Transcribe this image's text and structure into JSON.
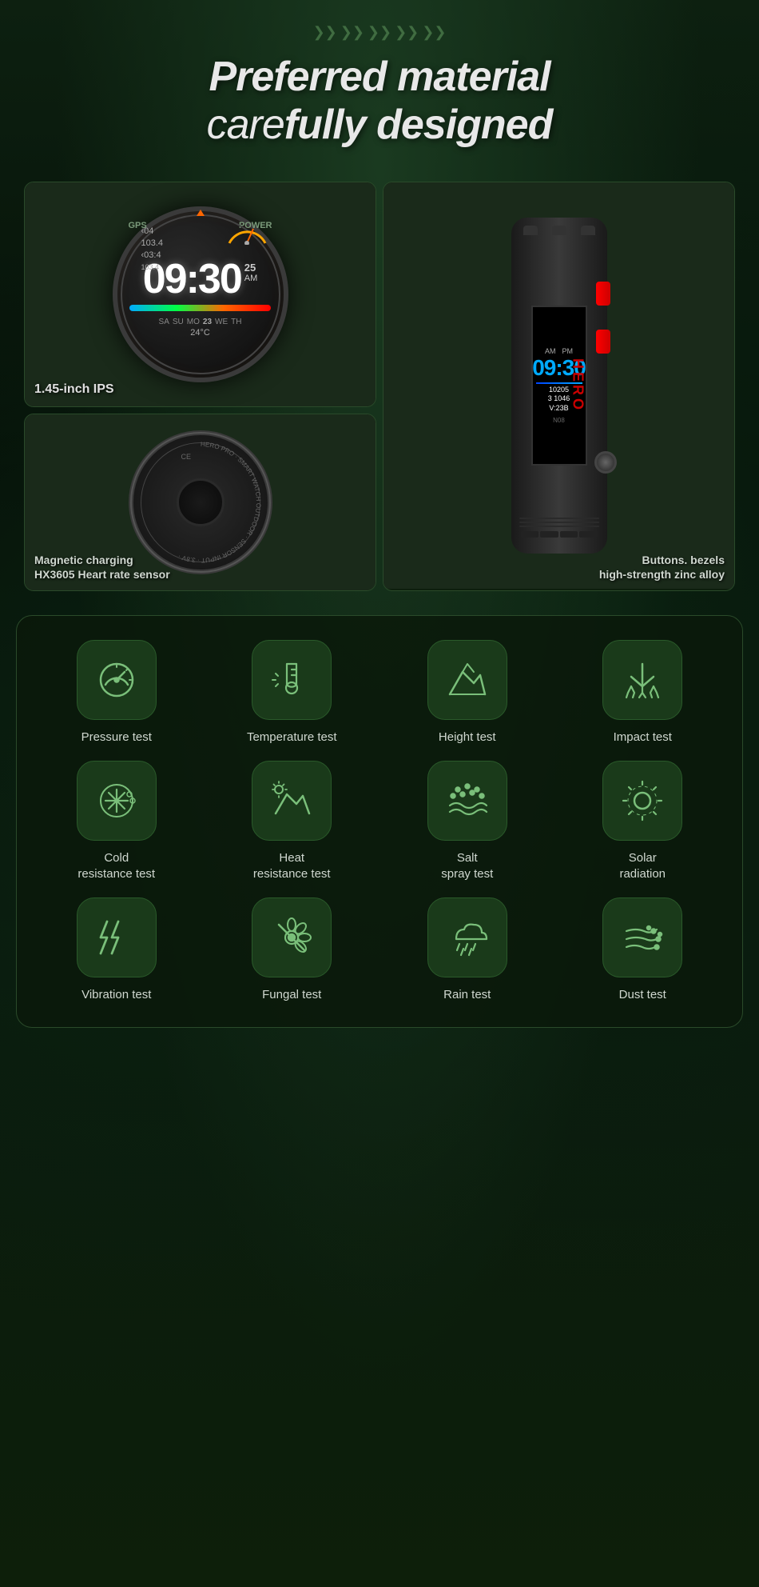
{
  "header": {
    "title_line1": "Preferred material",
    "title_line2": "care",
    "title_line2b": "fully designed",
    "chevrons": [
      "❯❯",
      "❯❯",
      "❯❯",
      "❯❯",
      "❯❯"
    ]
  },
  "watch_cards": {
    "top_left": {
      "label": "1.45-inch IPS",
      "time": "09:30",
      "am": "25 AM",
      "temp": "24°C"
    },
    "bottom_left": {
      "label_line1": "Magnetic charging",
      "label_line2": "HX3605 Heart rate sensor"
    },
    "right": {
      "label_line1": "Buttons. bezels",
      "label_line2": "high-strength zinc alloy"
    }
  },
  "tests": {
    "row1": [
      {
        "id": "pressure",
        "label": "Pressure test",
        "icon": "gauge"
      },
      {
        "id": "temperature",
        "label": "Temperature test",
        "icon": "thermometer"
      },
      {
        "id": "height",
        "label": "Height test",
        "icon": "mountain"
      },
      {
        "id": "impact",
        "label": "Impact test",
        "icon": "impact"
      }
    ],
    "row2": [
      {
        "id": "cold",
        "label": "Cold\nresistance test",
        "label_l1": "Cold",
        "label_l2": "resistance test",
        "icon": "cold"
      },
      {
        "id": "heat",
        "label": "Heat\nresistance test",
        "label_l1": "Heat",
        "label_l2": "resistance test",
        "icon": "heat"
      },
      {
        "id": "salt",
        "label": "Salt\nspray test",
        "label_l1": "Salt",
        "label_l2": "spray test",
        "icon": "salt"
      },
      {
        "id": "solar",
        "label": "Solar\nradiation",
        "label_l1": "Solar",
        "label_l2": "radiation",
        "icon": "sun"
      }
    ],
    "row3": [
      {
        "id": "vibration",
        "label": "Vibration test",
        "icon": "vibration"
      },
      {
        "id": "fungal",
        "label": "Fungal test",
        "icon": "fungal"
      },
      {
        "id": "rain",
        "label": "Rain test",
        "icon": "rain"
      },
      {
        "id": "dust",
        "label": "Dust test",
        "icon": "dust"
      }
    ]
  }
}
